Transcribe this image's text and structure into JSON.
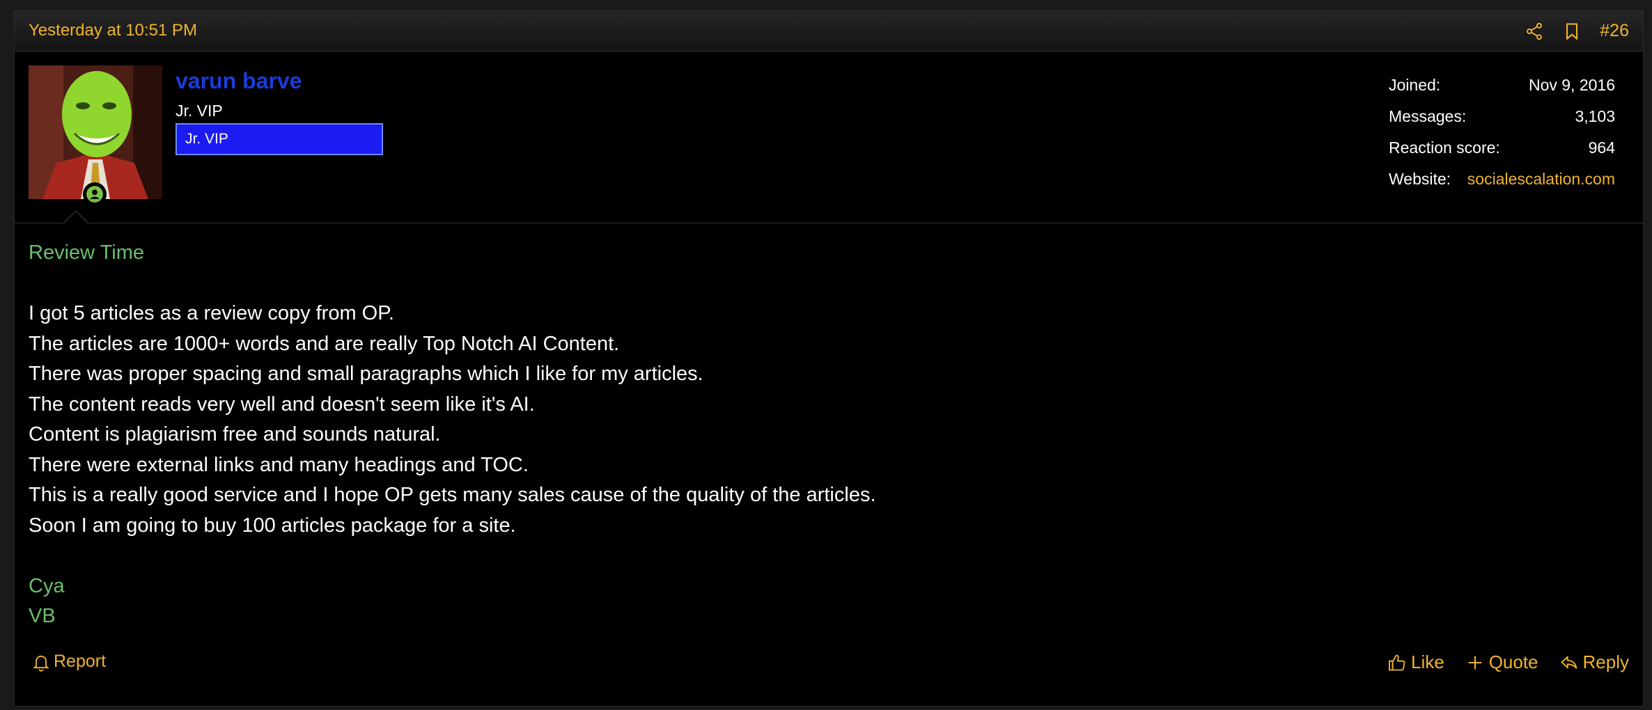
{
  "post": {
    "date": "Yesterday at 10:51 PM",
    "number": "#26"
  },
  "user": {
    "name": "varun barve",
    "title": "Jr. VIP",
    "banner": "Jr. VIP"
  },
  "stats": [
    {
      "label": "Joined:",
      "value": "Nov 9, 2016"
    },
    {
      "label": "Messages:",
      "value": "3,103"
    },
    {
      "label": "Reaction score:",
      "value": "964"
    },
    {
      "label": "Website:",
      "value": "socialescalation.com"
    }
  ],
  "content": {
    "heading": "Review Time",
    "lines": [
      "I got 5 articles as a review copy from OP.",
      "The articles are 1000+ words and are really Top Notch AI Content.",
      "There was proper spacing and small paragraphs which I like for my articles.",
      "The content reads very well and doesn't seem like it's AI.",
      "Content is plagiarism free and sounds natural.",
      "There were external links and many headings and TOC.",
      "This is a really good service and I hope OP gets many sales cause of the quality of the articles.",
      "Soon I am going to buy 100 articles package for a site."
    ],
    "signoff": [
      "Cya",
      "VB"
    ]
  },
  "actions": {
    "report": "Report",
    "like": "Like",
    "quote": "Quote",
    "reply": "Reply"
  },
  "colors": {
    "accent": "#f0b42a",
    "username": "#1d3bd8",
    "banner_bg": "#1c1cf2",
    "green_text": "#6bbf6b",
    "online": "#7cc242"
  },
  "icons": [
    "share-icon",
    "bookmark-icon",
    "online-status-icon",
    "bell-icon",
    "thumbs-up-icon",
    "plus-icon",
    "reply-arrow-icon"
  ]
}
